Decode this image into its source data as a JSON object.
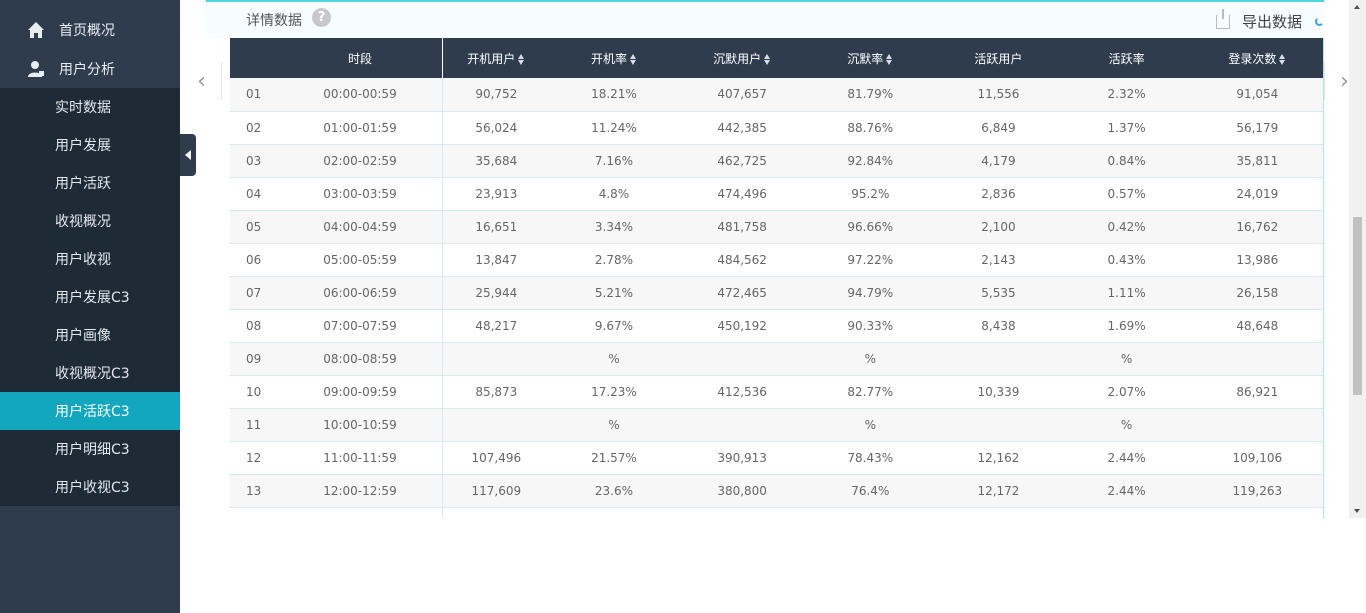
{
  "sidebar": {
    "top_items": [
      {
        "label": "首页概况",
        "icon": "home-icon"
      },
      {
        "label": "用户分析",
        "icon": "user-icon"
      }
    ],
    "sub_items": [
      {
        "label": "实时数据",
        "active": false
      },
      {
        "label": "用户发展",
        "active": false
      },
      {
        "label": "用户活跃",
        "active": false
      },
      {
        "label": "收视概况",
        "active": false
      },
      {
        "label": "用户收视",
        "active": false
      },
      {
        "label": "用户发展C3",
        "active": false
      },
      {
        "label": "用户画像",
        "active": false
      },
      {
        "label": "收视概况C3",
        "active": false
      },
      {
        "label": "用户活跃C3",
        "active": true
      },
      {
        "label": "用户明细C3",
        "active": false
      },
      {
        "label": "用户收视C3",
        "active": false
      }
    ]
  },
  "card": {
    "title": "详情数据",
    "help": "?",
    "export_label": "导出数据"
  },
  "colors": {
    "sidebar_bg": "#2e3c4e",
    "active_item": "#12a6bf",
    "accent_border": "#4fd3e3"
  },
  "table": {
    "headers": [
      "",
      "时段",
      "开机用户",
      "开机率",
      "沉默用户",
      "沉默率",
      "活跃用户",
      "活跃率",
      "登录次数"
    ],
    "sortable": [
      false,
      false,
      true,
      true,
      true,
      true,
      false,
      false,
      true
    ],
    "rows": [
      [
        "01",
        "00:00-00:59",
        "90,752",
        "18.21%",
        "407,657",
        "81.79%",
        "11,556",
        "2.32%",
        "91,054"
      ],
      [
        "02",
        "01:00-01:59",
        "56,024",
        "11.24%",
        "442,385",
        "88.76%",
        "6,849",
        "1.37%",
        "56,179"
      ],
      [
        "03",
        "02:00-02:59",
        "35,684",
        "7.16%",
        "462,725",
        "92.84%",
        "4,179",
        "0.84%",
        "35,811"
      ],
      [
        "04",
        "03:00-03:59",
        "23,913",
        "4.8%",
        "474,496",
        "95.2%",
        "2,836",
        "0.57%",
        "24,019"
      ],
      [
        "05",
        "04:00-04:59",
        "16,651",
        "3.34%",
        "481,758",
        "96.66%",
        "2,100",
        "0.42%",
        "16,762"
      ],
      [
        "06",
        "05:00-05:59",
        "13,847",
        "2.78%",
        "484,562",
        "97.22%",
        "2,143",
        "0.43%",
        "13,986"
      ],
      [
        "07",
        "06:00-06:59",
        "25,944",
        "5.21%",
        "472,465",
        "94.79%",
        "5,535",
        "1.11%",
        "26,158"
      ],
      [
        "08",
        "07:00-07:59",
        "48,217",
        "9.67%",
        "450,192",
        "90.33%",
        "8,438",
        "1.69%",
        "48,648"
      ],
      [
        "09",
        "08:00-08:59",
        "",
        "%",
        "",
        "%",
        "",
        "%",
        ""
      ],
      [
        "10",
        "09:00-09:59",
        "85,873",
        "17.23%",
        "412,536",
        "82.77%",
        "10,339",
        "2.07%",
        "86,921"
      ],
      [
        "11",
        "10:00-10:59",
        "",
        "%",
        "",
        "%",
        "",
        "%",
        ""
      ],
      [
        "12",
        "11:00-11:59",
        "107,496",
        "21.57%",
        "390,913",
        "78.43%",
        "12,162",
        "2.44%",
        "109,106"
      ],
      [
        "13",
        "12:00-12:59",
        "117,609",
        "23.6%",
        "380,800",
        "76.4%",
        "12,172",
        "2.44%",
        "119,263"
      ],
      [
        "",
        "",
        "",
        "",
        "",
        "",
        "",
        "",
        ""
      ]
    ]
  }
}
